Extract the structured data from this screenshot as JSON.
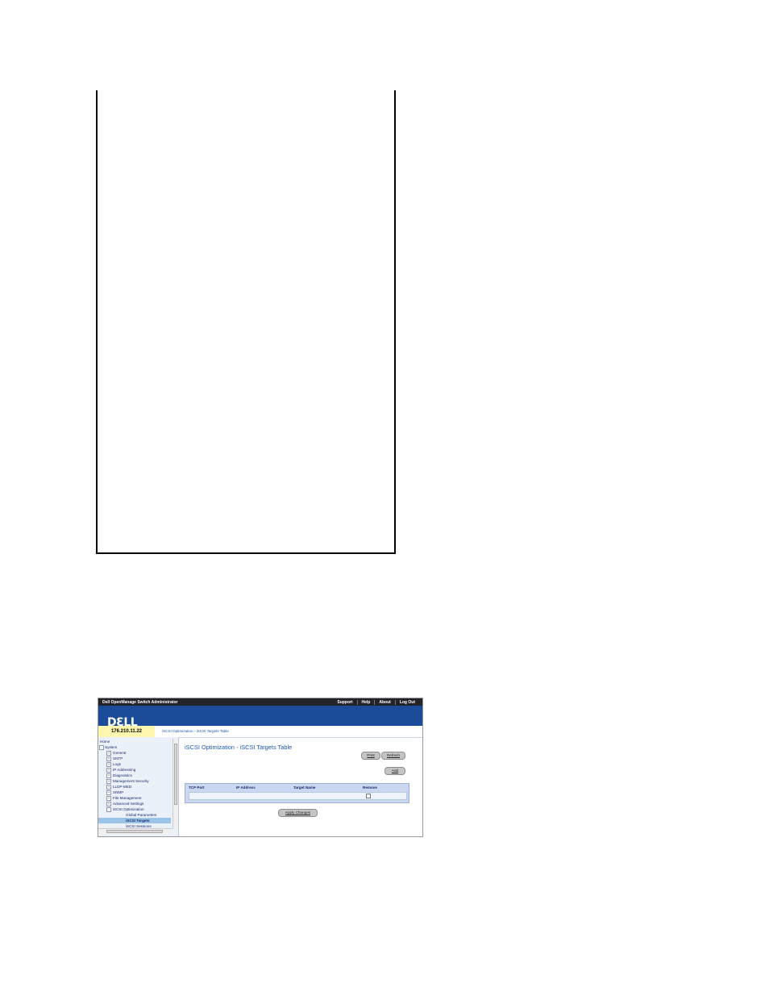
{
  "header": {
    "app_title": "Dell OpenManage Switch Administrator",
    "links": [
      "Support",
      "Help",
      "About",
      "Log Out"
    ]
  },
  "logo": "DƐLL",
  "address": {
    "ip": "176.210.11.22",
    "breadcrumb": "iSCSI Optimization - iSCSI Targets Table"
  },
  "tree": [
    {
      "label": "Home",
      "indent": 0,
      "icon": "home"
    },
    {
      "label": "System",
      "indent": 1,
      "exp": "-"
    },
    {
      "label": "General",
      "indent": 2,
      "exp": "+"
    },
    {
      "label": "SNTP",
      "indent": 2,
      "exp": "+"
    },
    {
      "label": "Logs",
      "indent": 2,
      "exp": "+"
    },
    {
      "label": "IP Addressing",
      "indent": 2,
      "exp": "+"
    },
    {
      "label": "Diagnostics",
      "indent": 2,
      "exp": "+"
    },
    {
      "label": "Management Security",
      "indent": 2,
      "exp": "+"
    },
    {
      "label": "LLDP-MED",
      "indent": 2,
      "exp": "+"
    },
    {
      "label": "SNMP",
      "indent": 2,
      "exp": "+"
    },
    {
      "label": "File Management",
      "indent": 2,
      "exp": "+"
    },
    {
      "label": "Advanced Settings",
      "indent": 2,
      "exp": "+"
    },
    {
      "label": "iSCSI Optimization",
      "indent": 2,
      "exp": "-"
    },
    {
      "label": "Global Parameters",
      "indent": 3
    },
    {
      "label": "iSCSI Targets",
      "indent": 3,
      "selected": true
    },
    {
      "label": "iSCSI Sessions",
      "indent": 3
    }
  ],
  "page": {
    "title": "iSCSI Optimization - iSCSI Targets Table",
    "print": "Print",
    "refresh": "Refresh",
    "add": "Add",
    "columns": [
      "TCP Port",
      "IP Address",
      "Target Name",
      "Remove"
    ],
    "apply": "Apply Changes"
  },
  "colors": {
    "banner": "#1a4c9a",
    "topbar": "#222428",
    "ip_bg": "#fff6b0",
    "table_header": "#c9d8f0"
  }
}
